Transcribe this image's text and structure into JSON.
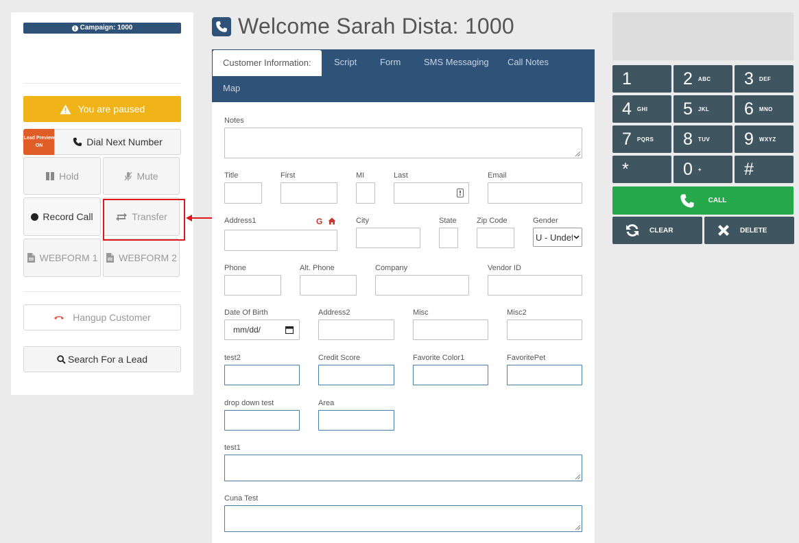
{
  "left_panel": {
    "campaign_label": "Campaign: 1000",
    "paused_text": "You are paused",
    "lead_preview_label": "Lead Preview",
    "lead_preview_state": "ON",
    "dial_next_label": "Dial Next Number",
    "hold_label": "Hold",
    "mute_label": "Mute",
    "record_label": "Record Call",
    "transfer_label": "Transfer",
    "webform1_label": "WEBFORM 1",
    "webform2_label": "WEBFORM 2",
    "hangup_label": "Hangup Customer",
    "search_label": "Search For a Lead"
  },
  "header": {
    "welcome": "Welcome Sarah Dista: 1000"
  },
  "tabs": [
    "Customer Information:",
    "Script",
    "Form",
    "SMS Messaging",
    "Call Notes",
    "Map"
  ],
  "form": {
    "notes": "Notes",
    "title": "Title",
    "first": "First",
    "mi": "MI",
    "last": "Last",
    "email": "Email",
    "address1": "Address1",
    "city": "City",
    "state": "State",
    "zip": "Zip Code",
    "gender": "Gender",
    "gender_value": "U - Undefined",
    "phone": "Phone",
    "alt_phone": "Alt. Phone",
    "company": "Company",
    "vendor_id": "Vendor ID",
    "dob": "Date Of Birth",
    "dob_placeholder": "mm/dd/",
    "address2": "Address2",
    "misc": "Misc",
    "misc2": "Misc2",
    "test2": "test2",
    "credit_score": "Credit Score",
    "favorite_color1": "Favorite Color1",
    "favorite_pet": "FavoritePet",
    "drop_down_test": "drop down test",
    "area": "Area",
    "test1": "test1",
    "cuna_test": "Cuna Test"
  },
  "dialpad": {
    "keys": [
      {
        "num": "1",
        "sub": ""
      },
      {
        "num": "2",
        "sub": "ABC"
      },
      {
        "num": "3",
        "sub": "DEF"
      },
      {
        "num": "4",
        "sub": "GHI"
      },
      {
        "num": "5",
        "sub": "JKL"
      },
      {
        "num": "6",
        "sub": "MNO"
      },
      {
        "num": "7",
        "sub": "PQRS"
      },
      {
        "num": "8",
        "sub": "TUV"
      },
      {
        "num": "9",
        "sub": "WXYZ"
      },
      {
        "num": "*",
        "sub": ""
      },
      {
        "num": "0",
        "sub": "+"
      },
      {
        "num": "#",
        "sub": ""
      }
    ],
    "call_label": "CALL",
    "clear_label": "CLEAR",
    "delete_label": "DELETE"
  },
  "colors": {
    "navy": "#2f5278",
    "paused_yellow": "#f0b418",
    "lead_preview_orange": "#e15d28",
    "dialpad_key": "#3f5560",
    "call_green": "#25a94a",
    "highlight_red": "#e0161b"
  },
  "icons": [
    "info-icon",
    "warning-icon",
    "phone-icon",
    "pause-icon",
    "mute-icon",
    "record-dot-icon",
    "transfer-icon",
    "document-icon",
    "hangup-icon",
    "search-icon",
    "google-icon",
    "home-icon",
    "contact-card-icon",
    "calendar-icon",
    "chevron-down-icon",
    "refresh-icon",
    "close-icon"
  ]
}
